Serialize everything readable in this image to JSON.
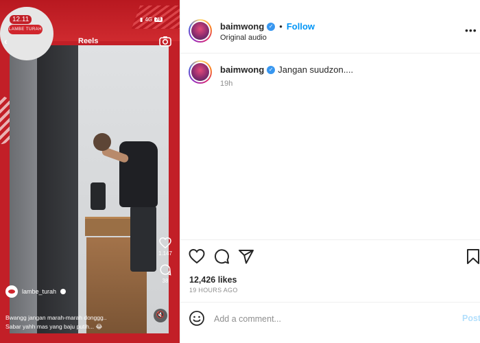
{
  "reel": {
    "status_time": "12.11",
    "brand_text": "LAMBE TURAH",
    "network": "4G",
    "battery": "78",
    "title": "Reels",
    "like_count": "1.147",
    "comment_count": "38",
    "username": "lambe_turah",
    "caption_line1": "Bwangg jangan marah-marah donggg..",
    "caption_line2": "Sabar yahh mas yang baju putih... 😂"
  },
  "post": {
    "author": "baimwong",
    "follow_label": "Follow",
    "audio": "Original audio",
    "caption_author": "baimwong",
    "caption_text": "Jangan suudzon....",
    "caption_time": "19h",
    "likes": "12,426 likes",
    "time_ago": "19 HOURS AGO",
    "comment_placeholder": "Add a comment...",
    "post_label": "Post"
  },
  "colors": {
    "brand_red": "#c21f27",
    "follow_blue": "#0095f6",
    "verified_blue": "#3897f0",
    "muted_text": "#8e8e8e"
  },
  "icons": [
    "back-arrow-icon",
    "camera-icon",
    "heart-icon",
    "comment-icon",
    "share-icon",
    "bookmark-icon",
    "emoji-icon",
    "more-icon",
    "verified-icon",
    "mute-icon"
  ]
}
